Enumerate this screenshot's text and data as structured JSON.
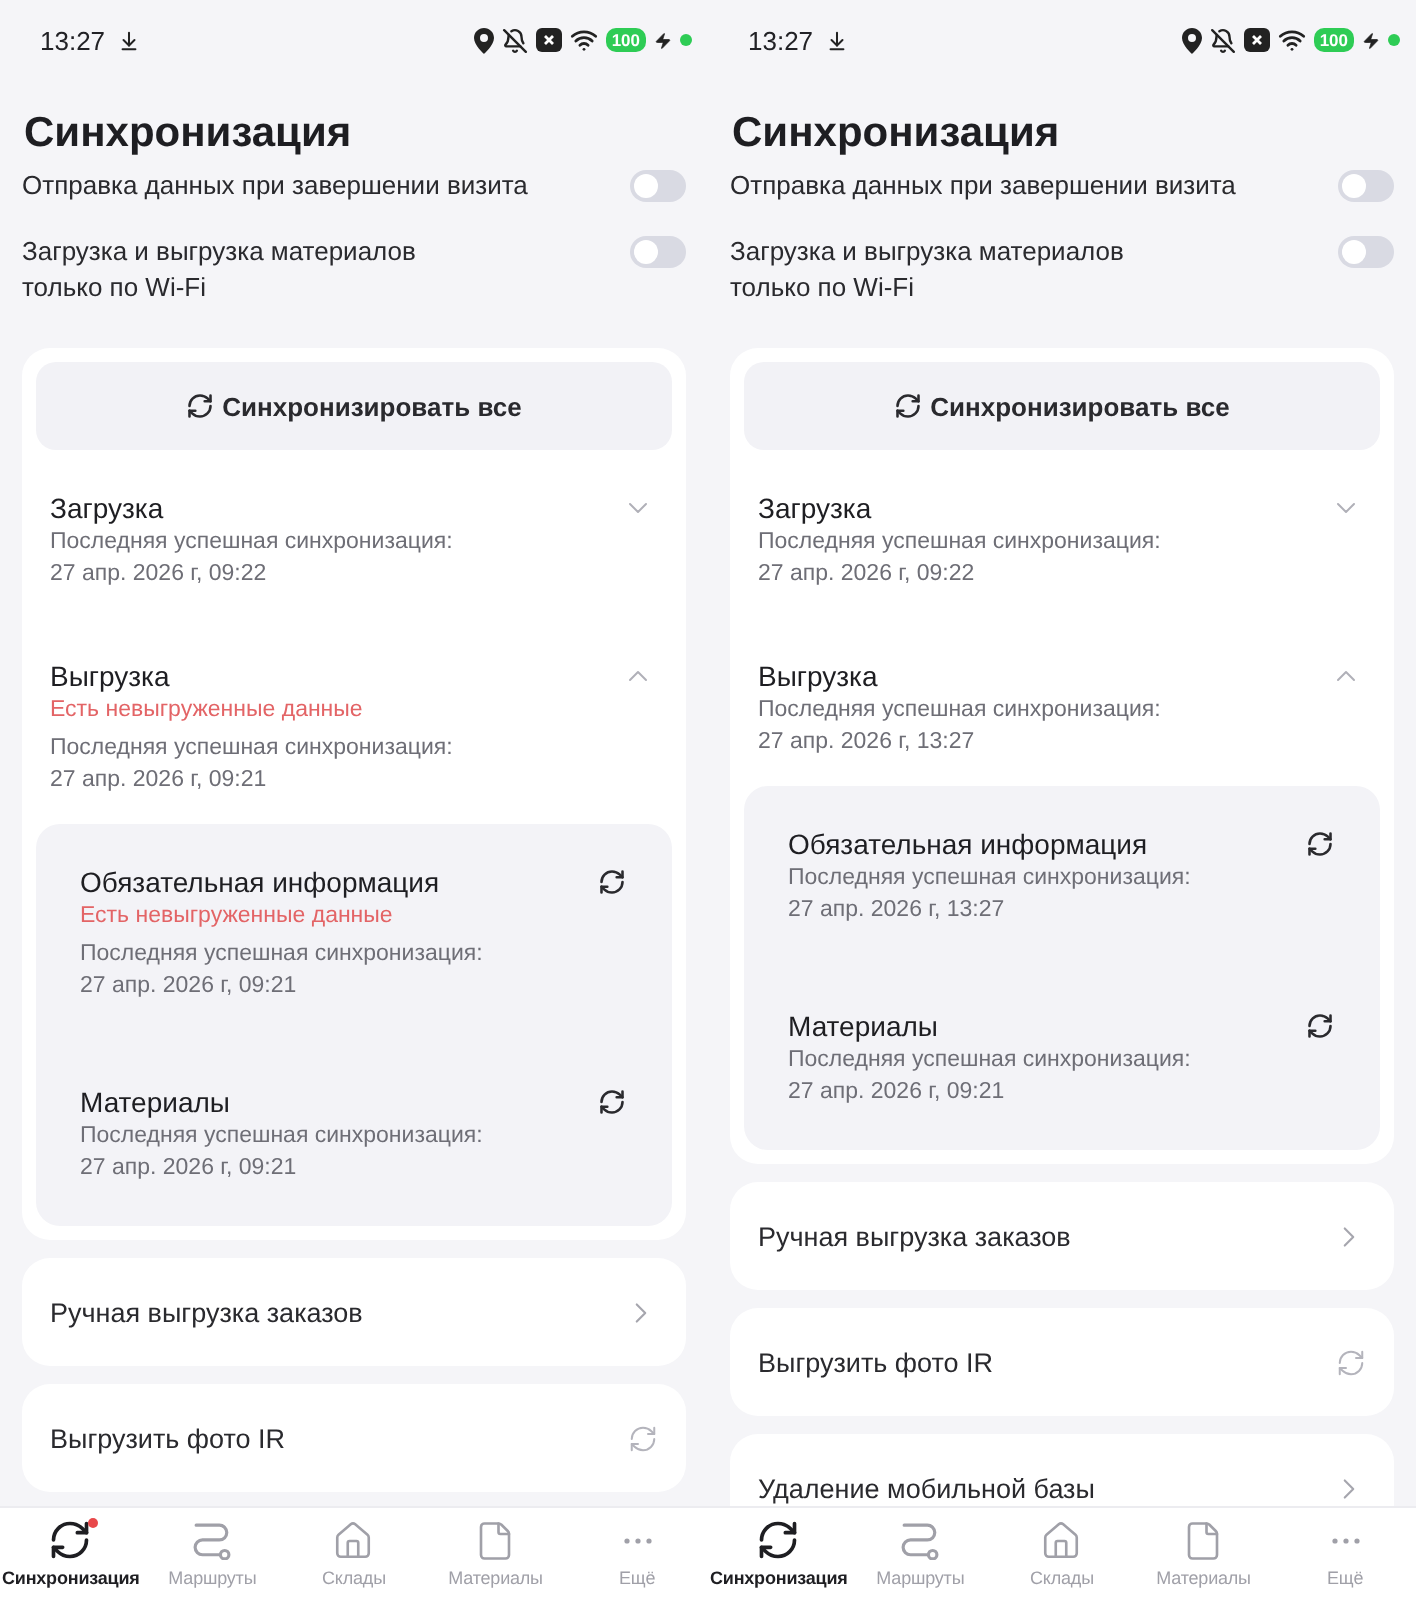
{
  "screens": [
    {
      "status_bar": {
        "time": "13:27",
        "battery": "100"
      },
      "title": "Синхронизация",
      "settings": [
        {
          "label": "Отправка данных при завершении визита",
          "on": false
        },
        {
          "label": "Загрузка и выгрузка материалов\nтолько по Wi-Fi",
          "on": false
        }
      ],
      "sync_all_button": "Синхронизировать все",
      "sections": [
        {
          "title": "Загрузка",
          "expanded": false,
          "last_sync_label": "Последняя успешная синхронизация:",
          "last_sync_time": "27 апр. 2026 г, 09:22"
        },
        {
          "title": "Выгрузка",
          "expanded": true,
          "warning": "Есть невыгруженные данные",
          "last_sync_label": "Последняя успешная синхронизация:",
          "last_sync_time": "27 апр. 2026 г, 09:21",
          "items": [
            {
              "title": "Обязательная информация",
              "warning": "Есть невыгруженные данные",
              "last_sync_label": "Последняя успешная синхронизация:",
              "last_sync_time": "27 апр. 2026 г, 09:21"
            },
            {
              "title": "Материалы",
              "last_sync_label": "Последняя успешная синхронизация:",
              "last_sync_time": "27 апр. 2026 г, 09:21"
            }
          ]
        }
      ],
      "links": [
        {
          "label": "Ручная выгрузка заказов",
          "kind": "chevron"
        },
        {
          "label": "Выгрузить фото IR",
          "kind": "refresh"
        }
      ],
      "nav": [
        {
          "label": "Синхронизация",
          "kind": "sync",
          "selected": true,
          "badge": true
        },
        {
          "label": "Маршруты",
          "kind": "route",
          "selected": false,
          "badge": false
        },
        {
          "label": "Склады",
          "kind": "warehouse",
          "selected": false,
          "badge": false
        },
        {
          "label": "Материалы",
          "kind": "document",
          "selected": false,
          "badge": false
        },
        {
          "label": "Ещё",
          "kind": "more",
          "selected": false,
          "badge": false
        }
      ]
    },
    {
      "status_bar": {
        "time": "13:27",
        "battery": "100"
      },
      "title": "Синхронизация",
      "settings": [
        {
          "label": "Отправка данных при завершении визита",
          "on": false
        },
        {
          "label": "Загрузка и выгрузка материалов\nтолько по Wi-Fi",
          "on": false
        }
      ],
      "sync_all_button": "Синхронизировать все",
      "sections": [
        {
          "title": "Загрузка",
          "expanded": false,
          "last_sync_label": "Последняя успешная синхронизация:",
          "last_sync_time": "27 апр. 2026 г, 09:22"
        },
        {
          "title": "Выгрузка",
          "expanded": true,
          "last_sync_label": "Последняя успешная синхронизация:",
          "last_sync_time": "27 апр. 2026 г, 13:27",
          "items": [
            {
              "title": "Обязательная информация",
              "last_sync_label": "Последняя успешная синхронизация:",
              "last_sync_time": "27 апр. 2026 г, 13:27"
            },
            {
              "title": "Материалы",
              "last_sync_label": "Последняя успешная синхронизация:",
              "last_sync_time": "27 апр. 2026 г, 09:21"
            }
          ]
        }
      ],
      "links": [
        {
          "label": "Ручная выгрузка заказов",
          "kind": "chevron"
        },
        {
          "label": "Выгрузить фото IR",
          "kind": "refresh"
        },
        {
          "label": "Удаление мобильной базы",
          "kind": "chevron"
        }
      ],
      "nav": [
        {
          "label": "Синхронизация",
          "kind": "sync",
          "selected": true,
          "badge": false
        },
        {
          "label": "Маршруты",
          "kind": "route",
          "selected": false,
          "badge": false
        },
        {
          "label": "Склады",
          "kind": "warehouse",
          "selected": false,
          "badge": false
        },
        {
          "label": "Материалы",
          "kind": "document",
          "selected": false,
          "badge": false
        },
        {
          "label": "Ещё",
          "kind": "more",
          "selected": false,
          "badge": false
        }
      ]
    }
  ]
}
